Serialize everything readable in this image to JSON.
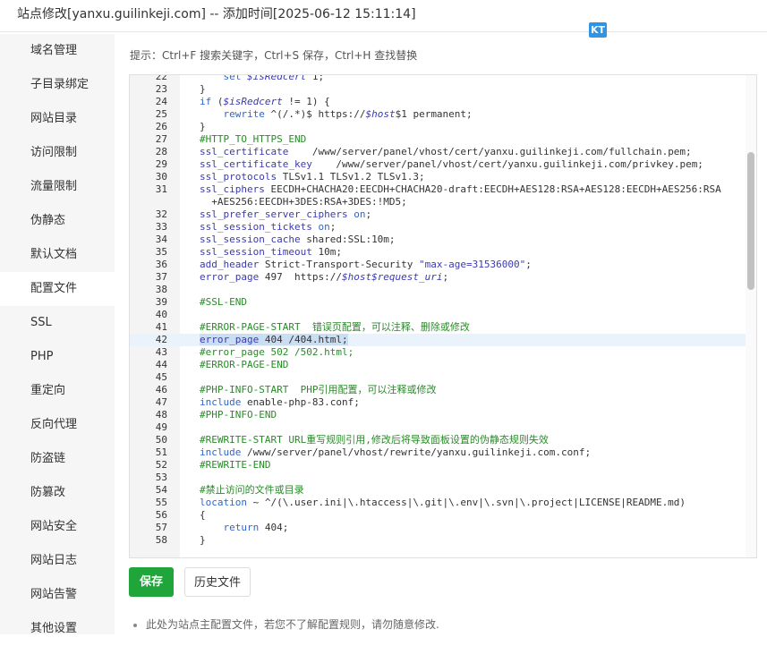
{
  "window": {
    "title": "站点修改[yanxu.guilinkeji.com] -- 添加时间[2025-06-12 15:11:14]",
    "badge": "KT"
  },
  "sidebar": {
    "items": [
      {
        "label": "域名管理",
        "active": false
      },
      {
        "label": "子目录绑定",
        "active": false
      },
      {
        "label": "网站目录",
        "active": false
      },
      {
        "label": "访问限制",
        "active": false
      },
      {
        "label": "流量限制",
        "active": false
      },
      {
        "label": "伪静态",
        "active": false
      },
      {
        "label": "默认文档",
        "active": false
      },
      {
        "label": "配置文件",
        "active": true
      },
      {
        "label": "SSL",
        "active": false
      },
      {
        "label": "PHP",
        "active": false
      },
      {
        "label": "重定向",
        "active": false
      },
      {
        "label": "反向代理",
        "active": false
      },
      {
        "label": "防盗链",
        "active": false
      },
      {
        "label": "防篡改",
        "active": false
      },
      {
        "label": "网站安全",
        "active": false
      },
      {
        "label": "网站日志",
        "active": false
      },
      {
        "label": "网站告警",
        "active": false
      },
      {
        "label": "其他设置",
        "active": false
      }
    ]
  },
  "hint": "提示：Ctrl+F 搜索关键字，Ctrl+S 保存，Ctrl+H 查找替换",
  "editor": {
    "highlighted_line": "42",
    "lines": [
      {
        "n": "22",
        "html": "    <span class=\"kw\">set</span> <span class=\"var\">$isRedcert</span> 1;"
      },
      {
        "n": "23",
        "html": "}"
      },
      {
        "n": "24",
        "html": "<span class=\"kw\">if</span> (<span class=\"var\">$isRedcert</span> != 1) {"
      },
      {
        "n": "25",
        "html": "    <span class=\"kw\">rewrite</span> ^(/.*)$ https://<span class=\"var\">$host</span>$1 permanent;"
      },
      {
        "n": "26",
        "html": "}"
      },
      {
        "n": "27",
        "html": "<span class=\"cmt\">#HTTP_TO_HTTPS_END</span>"
      },
      {
        "n": "28",
        "html": "<span class=\"dir\">ssl_certificate</span>    /www/server/panel/vhost/cert/yanxu.guilinkeji.com/fullchain.pem;"
      },
      {
        "n": "29",
        "html": "<span class=\"dir\">ssl_certificate_key</span>    /www/server/panel/vhost/cert/yanxu.guilinkeji.com/privkey.pem;"
      },
      {
        "n": "30",
        "html": "<span class=\"dir\">ssl_protocols</span> TLSv1.1 TLSv1.2 TLSv1.3;"
      },
      {
        "n": "31",
        "tall": true,
        "html": "<span class=\"dir\">ssl_ciphers</span> EECDH+CHACHA20:EECDH+CHACHA20-draft:EECDH+AES128:RSA+AES128:EECDH+AES256:RSA\n  +AES256:EECDH+3DES:RSA+3DES:!MD5;"
      },
      {
        "n": "32",
        "html": "<span class=\"dir\">ssl_prefer_server_ciphers</span> <span class=\"kw\">on</span>;"
      },
      {
        "n": "33",
        "html": "<span class=\"dir\">ssl_session_tickets</span> <span class=\"kw\">on</span>;"
      },
      {
        "n": "34",
        "html": "<span class=\"dir\">ssl_session_cache</span> shared:SSL:10m;"
      },
      {
        "n": "35",
        "html": "<span class=\"dir\">ssl_session_timeout</span> 10m;"
      },
      {
        "n": "36",
        "html": "<span class=\"dir\">add_header</span> Strict-Transport-Security <span class=\"str\">\"max-age=31536000\"</span>;"
      },
      {
        "n": "37",
        "html": "<span class=\"dir\">error_page</span> 497  https://<span class=\"var\">$host$request_uri</span>;"
      },
      {
        "n": "38",
        "html": ""
      },
      {
        "n": "39",
        "html": "<span class=\"cmt\">#SSL-END</span>"
      },
      {
        "n": "40",
        "html": ""
      },
      {
        "n": "41",
        "html": "<span class=\"cmt\">#ERROR-PAGE-START  错误页配置，可以注释、删除或修改</span>"
      },
      {
        "n": "42",
        "hl": true,
        "html": "<span class=\"sel\"><span class=\"dir\">error_page</span> 404 /404.html;</span>"
      },
      {
        "n": "43",
        "html": "<span class=\"cmt\">#error_page 502 /502.html;</span>"
      },
      {
        "n": "44",
        "html": "<span class=\"cmt\">#ERROR-PAGE-END</span>"
      },
      {
        "n": "45",
        "html": ""
      },
      {
        "n": "46",
        "html": "<span class=\"cmt\">#PHP-INFO-START  PHP引用配置，可以注释或修改</span>"
      },
      {
        "n": "47",
        "html": "<span class=\"kw\">include</span> enable-php-83.conf;"
      },
      {
        "n": "48",
        "html": "<span class=\"cmt\">#PHP-INFO-END</span>"
      },
      {
        "n": "49",
        "html": ""
      },
      {
        "n": "50",
        "html": "<span class=\"cmt\">#REWRITE-START URL重写规则引用,修改后将导致面板设置的伪静态规则失效</span>"
      },
      {
        "n": "51",
        "html": "<span class=\"kw\">include</span> /www/server/panel/vhost/rewrite/yanxu.guilinkeji.com.conf;"
      },
      {
        "n": "52",
        "html": "<span class=\"cmt\">#REWRITE-END</span>"
      },
      {
        "n": "53",
        "html": ""
      },
      {
        "n": "54",
        "html": "<span class=\"cmt\">#禁止访问的文件或目录</span>"
      },
      {
        "n": "55",
        "html": "<span class=\"kw\">location</span> ~ ^/(\\.user.ini|\\.htaccess|\\.git|\\.env|\\.svn|\\.project|LICENSE|README.md)"
      },
      {
        "n": "56",
        "html": "{"
      },
      {
        "n": "57",
        "html": "    <span class=\"kw\">return</span> 404;"
      },
      {
        "n": "58",
        "html": "}"
      }
    ]
  },
  "buttons": {
    "save": "保存",
    "history": "历史文件"
  },
  "note": "此处为站点主配置文件，若您不了解配置规则，请勿随意修改."
}
